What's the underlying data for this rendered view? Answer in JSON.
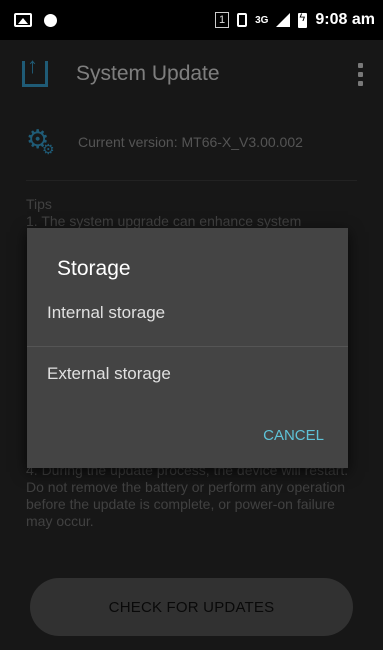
{
  "status_bar": {
    "sim_slot": "1",
    "network": "3G",
    "time": "9:08 am"
  },
  "app_bar": {
    "title": "System Update",
    "icon": "upload-icon",
    "menu_icon": "overflow-menu-icon"
  },
  "version": {
    "text": "Current version: MT66-X_V3.00.002"
  },
  "tips": {
    "title": "Tips",
    "item1": "1. The system upgrade can enhance system",
    "item4": "4. During the update process, the device will restart. Do not remove the battery or perform any operation before the update is complete, or power-on failure may occur."
  },
  "check_button": {
    "label": "CHECK FOR UPDATES"
  },
  "dialog": {
    "title": "Storage",
    "options": [
      "Internal storage",
      "External storage"
    ],
    "cancel_label": "CANCEL"
  },
  "colors": {
    "accent": "#3aa7d8",
    "dialog_button": "#5ec3d8",
    "dialog_bg": "#444444",
    "app_bar_bg": "#2b2b2b"
  }
}
